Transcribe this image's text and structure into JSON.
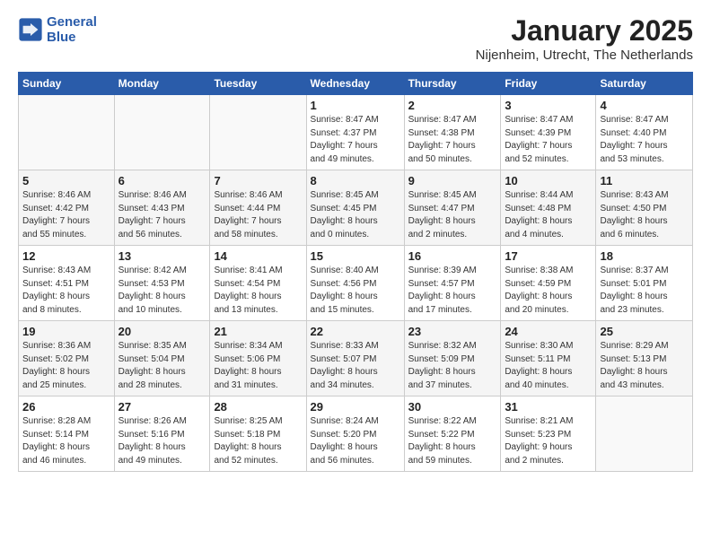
{
  "header": {
    "logo_line1": "General",
    "logo_line2": "Blue",
    "month_title": "January 2025",
    "subtitle": "Nijenheim, Utrecht, The Netherlands"
  },
  "weekdays": [
    "Sunday",
    "Monday",
    "Tuesday",
    "Wednesday",
    "Thursday",
    "Friday",
    "Saturday"
  ],
  "weeks": [
    [
      {
        "day": "",
        "info": ""
      },
      {
        "day": "",
        "info": ""
      },
      {
        "day": "",
        "info": ""
      },
      {
        "day": "1",
        "info": "Sunrise: 8:47 AM\nSunset: 4:37 PM\nDaylight: 7 hours\nand 49 minutes."
      },
      {
        "day": "2",
        "info": "Sunrise: 8:47 AM\nSunset: 4:38 PM\nDaylight: 7 hours\nand 50 minutes."
      },
      {
        "day": "3",
        "info": "Sunrise: 8:47 AM\nSunset: 4:39 PM\nDaylight: 7 hours\nand 52 minutes."
      },
      {
        "day": "4",
        "info": "Sunrise: 8:47 AM\nSunset: 4:40 PM\nDaylight: 7 hours\nand 53 minutes."
      }
    ],
    [
      {
        "day": "5",
        "info": "Sunrise: 8:46 AM\nSunset: 4:42 PM\nDaylight: 7 hours\nand 55 minutes."
      },
      {
        "day": "6",
        "info": "Sunrise: 8:46 AM\nSunset: 4:43 PM\nDaylight: 7 hours\nand 56 minutes."
      },
      {
        "day": "7",
        "info": "Sunrise: 8:46 AM\nSunset: 4:44 PM\nDaylight: 7 hours\nand 58 minutes."
      },
      {
        "day": "8",
        "info": "Sunrise: 8:45 AM\nSunset: 4:45 PM\nDaylight: 8 hours\nand 0 minutes."
      },
      {
        "day": "9",
        "info": "Sunrise: 8:45 AM\nSunset: 4:47 PM\nDaylight: 8 hours\nand 2 minutes."
      },
      {
        "day": "10",
        "info": "Sunrise: 8:44 AM\nSunset: 4:48 PM\nDaylight: 8 hours\nand 4 minutes."
      },
      {
        "day": "11",
        "info": "Sunrise: 8:43 AM\nSunset: 4:50 PM\nDaylight: 8 hours\nand 6 minutes."
      }
    ],
    [
      {
        "day": "12",
        "info": "Sunrise: 8:43 AM\nSunset: 4:51 PM\nDaylight: 8 hours\nand 8 minutes."
      },
      {
        "day": "13",
        "info": "Sunrise: 8:42 AM\nSunset: 4:53 PM\nDaylight: 8 hours\nand 10 minutes."
      },
      {
        "day": "14",
        "info": "Sunrise: 8:41 AM\nSunset: 4:54 PM\nDaylight: 8 hours\nand 13 minutes."
      },
      {
        "day": "15",
        "info": "Sunrise: 8:40 AM\nSunset: 4:56 PM\nDaylight: 8 hours\nand 15 minutes."
      },
      {
        "day": "16",
        "info": "Sunrise: 8:39 AM\nSunset: 4:57 PM\nDaylight: 8 hours\nand 17 minutes."
      },
      {
        "day": "17",
        "info": "Sunrise: 8:38 AM\nSunset: 4:59 PM\nDaylight: 8 hours\nand 20 minutes."
      },
      {
        "day": "18",
        "info": "Sunrise: 8:37 AM\nSunset: 5:01 PM\nDaylight: 8 hours\nand 23 minutes."
      }
    ],
    [
      {
        "day": "19",
        "info": "Sunrise: 8:36 AM\nSunset: 5:02 PM\nDaylight: 8 hours\nand 25 minutes."
      },
      {
        "day": "20",
        "info": "Sunrise: 8:35 AM\nSunset: 5:04 PM\nDaylight: 8 hours\nand 28 minutes."
      },
      {
        "day": "21",
        "info": "Sunrise: 8:34 AM\nSunset: 5:06 PM\nDaylight: 8 hours\nand 31 minutes."
      },
      {
        "day": "22",
        "info": "Sunrise: 8:33 AM\nSunset: 5:07 PM\nDaylight: 8 hours\nand 34 minutes."
      },
      {
        "day": "23",
        "info": "Sunrise: 8:32 AM\nSunset: 5:09 PM\nDaylight: 8 hours\nand 37 minutes."
      },
      {
        "day": "24",
        "info": "Sunrise: 8:30 AM\nSunset: 5:11 PM\nDaylight: 8 hours\nand 40 minutes."
      },
      {
        "day": "25",
        "info": "Sunrise: 8:29 AM\nSunset: 5:13 PM\nDaylight: 8 hours\nand 43 minutes."
      }
    ],
    [
      {
        "day": "26",
        "info": "Sunrise: 8:28 AM\nSunset: 5:14 PM\nDaylight: 8 hours\nand 46 minutes."
      },
      {
        "day": "27",
        "info": "Sunrise: 8:26 AM\nSunset: 5:16 PM\nDaylight: 8 hours\nand 49 minutes."
      },
      {
        "day": "28",
        "info": "Sunrise: 8:25 AM\nSunset: 5:18 PM\nDaylight: 8 hours\nand 52 minutes."
      },
      {
        "day": "29",
        "info": "Sunrise: 8:24 AM\nSunset: 5:20 PM\nDaylight: 8 hours\nand 56 minutes."
      },
      {
        "day": "30",
        "info": "Sunrise: 8:22 AM\nSunset: 5:22 PM\nDaylight: 8 hours\nand 59 minutes."
      },
      {
        "day": "31",
        "info": "Sunrise: 8:21 AM\nSunset: 5:23 PM\nDaylight: 9 hours\nand 2 minutes."
      },
      {
        "day": "",
        "info": ""
      }
    ]
  ]
}
